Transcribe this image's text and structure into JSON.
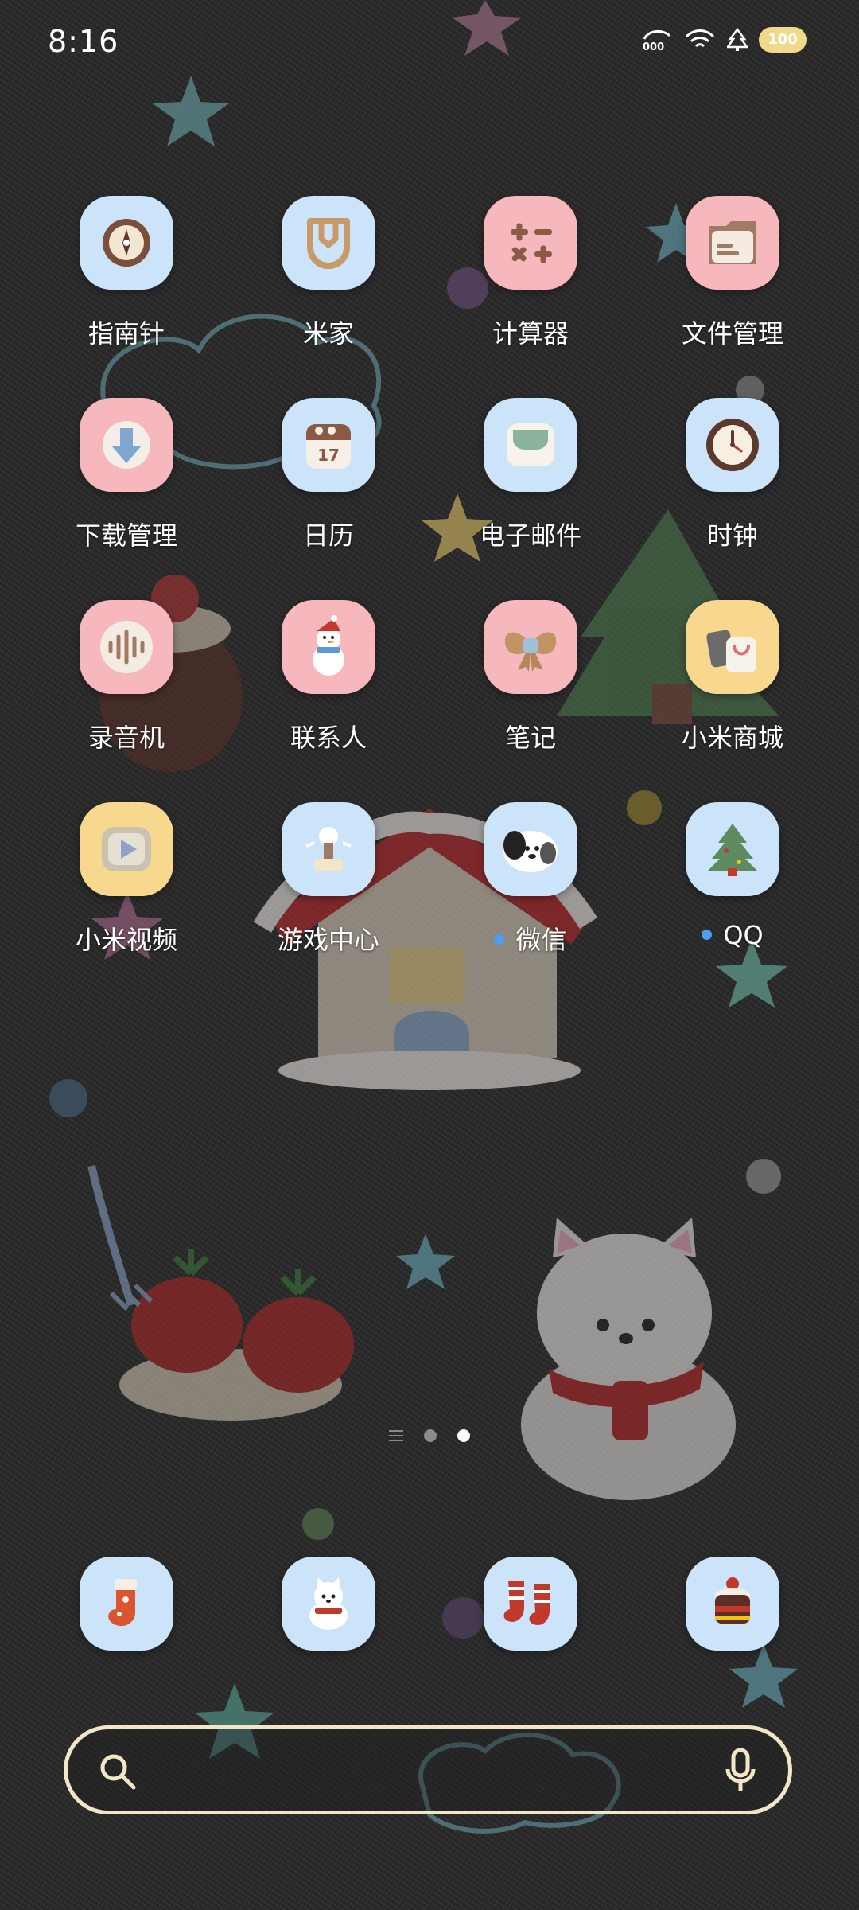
{
  "status_bar": {
    "time": "8:16",
    "battery": "100",
    "signal_label": "000"
  },
  "apps": [
    {
      "name": "指南针",
      "icon": "compass-icon",
      "color": "blue",
      "badge": false
    },
    {
      "name": "米家",
      "icon": "mijia-icon",
      "color": "blue",
      "badge": false
    },
    {
      "name": "计算器",
      "icon": "calculator-icon",
      "color": "pink",
      "badge": false
    },
    {
      "name": "文件管理",
      "icon": "folder-icon",
      "color": "pink",
      "badge": false
    },
    {
      "name": "下载管理",
      "icon": "download-icon",
      "color": "pink",
      "badge": false
    },
    {
      "name": "日历",
      "icon": "calendar-icon",
      "color": "blue",
      "badge": false,
      "icon_text": "17"
    },
    {
      "name": "电子邮件",
      "icon": "mail-icon",
      "color": "blue",
      "badge": false
    },
    {
      "name": "时钟",
      "icon": "clock-icon",
      "color": "blue",
      "badge": false
    },
    {
      "name": "录音机",
      "icon": "recorder-icon",
      "color": "pink",
      "badge": false
    },
    {
      "name": "联系人",
      "icon": "snowman-icon",
      "color": "pink",
      "badge": false
    },
    {
      "name": "笔记",
      "icon": "notes-icon",
      "color": "pink",
      "badge": false
    },
    {
      "name": "小米商城",
      "icon": "shopping-bag-icon",
      "color": "yellow",
      "badge": false
    },
    {
      "name": "小米视频",
      "icon": "video-play-icon",
      "color": "yellow",
      "badge": false
    },
    {
      "name": "游戏中心",
      "icon": "game-center-icon",
      "color": "blue",
      "badge": false
    },
    {
      "name": "微信",
      "icon": "wechat-dog-icon",
      "color": "blue",
      "badge": true
    },
    {
      "name": "QQ",
      "icon": "christmas-tree-icon",
      "color": "blue",
      "badge": true
    }
  ],
  "page_indicator": {
    "pages": 2,
    "active_index": 1
  },
  "dock": [
    {
      "icon": "stocking-icon",
      "color": "blue"
    },
    {
      "icon": "puppy-icon",
      "color": "blue"
    },
    {
      "icon": "socks-icon",
      "color": "blue"
    },
    {
      "icon": "cake-icon",
      "color": "blue"
    }
  ],
  "search": {
    "placeholder": ""
  },
  "colors": {
    "accent_blue": "#cbe4fa",
    "accent_pink": "#f7b8bd",
    "accent_yellow": "#f8d78e",
    "badge_blue": "#4c9ef0",
    "search_border": "#f3e6c8"
  }
}
